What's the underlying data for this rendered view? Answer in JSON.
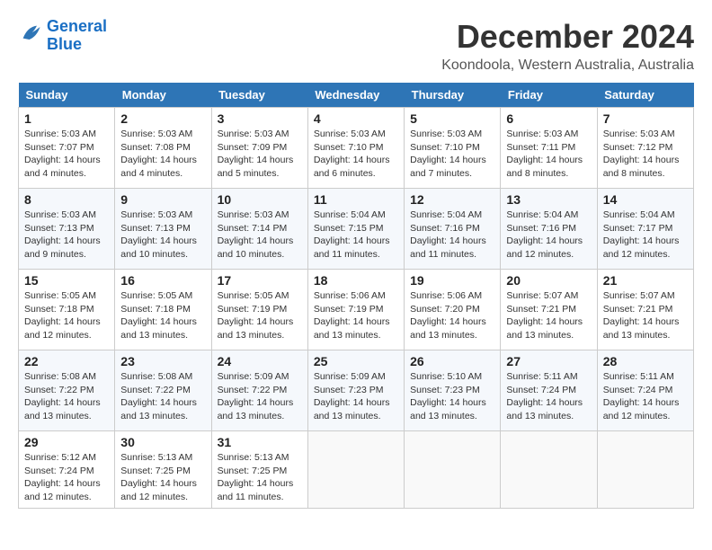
{
  "logo": {
    "line1": "General",
    "line2": "Blue"
  },
  "title": "December 2024",
  "location": "Koondoola, Western Australia, Australia",
  "days_of_week": [
    "Sunday",
    "Monday",
    "Tuesday",
    "Wednesday",
    "Thursday",
    "Friday",
    "Saturday"
  ],
  "weeks": [
    [
      {
        "day": "1",
        "sunrise": "5:03 AM",
        "sunset": "7:07 PM",
        "daylight": "14 hours and 4 minutes."
      },
      {
        "day": "2",
        "sunrise": "5:03 AM",
        "sunset": "7:08 PM",
        "daylight": "14 hours and 4 minutes."
      },
      {
        "day": "3",
        "sunrise": "5:03 AM",
        "sunset": "7:09 PM",
        "daylight": "14 hours and 5 minutes."
      },
      {
        "day": "4",
        "sunrise": "5:03 AM",
        "sunset": "7:10 PM",
        "daylight": "14 hours and 6 minutes."
      },
      {
        "day": "5",
        "sunrise": "5:03 AM",
        "sunset": "7:10 PM",
        "daylight": "14 hours and 7 minutes."
      },
      {
        "day": "6",
        "sunrise": "5:03 AM",
        "sunset": "7:11 PM",
        "daylight": "14 hours and 8 minutes."
      },
      {
        "day": "7",
        "sunrise": "5:03 AM",
        "sunset": "7:12 PM",
        "daylight": "14 hours and 8 minutes."
      }
    ],
    [
      {
        "day": "8",
        "sunrise": "5:03 AM",
        "sunset": "7:13 PM",
        "daylight": "14 hours and 9 minutes."
      },
      {
        "day": "9",
        "sunrise": "5:03 AM",
        "sunset": "7:13 PM",
        "daylight": "14 hours and 10 minutes."
      },
      {
        "day": "10",
        "sunrise": "5:03 AM",
        "sunset": "7:14 PM",
        "daylight": "14 hours and 10 minutes."
      },
      {
        "day": "11",
        "sunrise": "5:04 AM",
        "sunset": "7:15 PM",
        "daylight": "14 hours and 11 minutes."
      },
      {
        "day": "12",
        "sunrise": "5:04 AM",
        "sunset": "7:16 PM",
        "daylight": "14 hours and 11 minutes."
      },
      {
        "day": "13",
        "sunrise": "5:04 AM",
        "sunset": "7:16 PM",
        "daylight": "14 hours and 12 minutes."
      },
      {
        "day": "14",
        "sunrise": "5:04 AM",
        "sunset": "7:17 PM",
        "daylight": "14 hours and 12 minutes."
      }
    ],
    [
      {
        "day": "15",
        "sunrise": "5:05 AM",
        "sunset": "7:18 PM",
        "daylight": "14 hours and 12 minutes."
      },
      {
        "day": "16",
        "sunrise": "5:05 AM",
        "sunset": "7:18 PM",
        "daylight": "14 hours and 13 minutes."
      },
      {
        "day": "17",
        "sunrise": "5:05 AM",
        "sunset": "7:19 PM",
        "daylight": "14 hours and 13 minutes."
      },
      {
        "day": "18",
        "sunrise": "5:06 AM",
        "sunset": "7:19 PM",
        "daylight": "14 hours and 13 minutes."
      },
      {
        "day": "19",
        "sunrise": "5:06 AM",
        "sunset": "7:20 PM",
        "daylight": "14 hours and 13 minutes."
      },
      {
        "day": "20",
        "sunrise": "5:07 AM",
        "sunset": "7:21 PM",
        "daylight": "14 hours and 13 minutes."
      },
      {
        "day": "21",
        "sunrise": "5:07 AM",
        "sunset": "7:21 PM",
        "daylight": "14 hours and 13 minutes."
      }
    ],
    [
      {
        "day": "22",
        "sunrise": "5:08 AM",
        "sunset": "7:22 PM",
        "daylight": "14 hours and 13 minutes."
      },
      {
        "day": "23",
        "sunrise": "5:08 AM",
        "sunset": "7:22 PM",
        "daylight": "14 hours and 13 minutes."
      },
      {
        "day": "24",
        "sunrise": "5:09 AM",
        "sunset": "7:22 PM",
        "daylight": "14 hours and 13 minutes."
      },
      {
        "day": "25",
        "sunrise": "5:09 AM",
        "sunset": "7:23 PM",
        "daylight": "14 hours and 13 minutes."
      },
      {
        "day": "26",
        "sunrise": "5:10 AM",
        "sunset": "7:23 PM",
        "daylight": "14 hours and 13 minutes."
      },
      {
        "day": "27",
        "sunrise": "5:11 AM",
        "sunset": "7:24 PM",
        "daylight": "14 hours and 13 minutes."
      },
      {
        "day": "28",
        "sunrise": "5:11 AM",
        "sunset": "7:24 PM",
        "daylight": "14 hours and 12 minutes."
      }
    ],
    [
      {
        "day": "29",
        "sunrise": "5:12 AM",
        "sunset": "7:24 PM",
        "daylight": "14 hours and 12 minutes."
      },
      {
        "day": "30",
        "sunrise": "5:13 AM",
        "sunset": "7:25 PM",
        "daylight": "14 hours and 12 minutes."
      },
      {
        "day": "31",
        "sunrise": "5:13 AM",
        "sunset": "7:25 PM",
        "daylight": "14 hours and 11 minutes."
      },
      null,
      null,
      null,
      null
    ]
  ],
  "labels": {
    "sunrise": "Sunrise:",
    "sunset": "Sunset:",
    "daylight": "Daylight:"
  }
}
